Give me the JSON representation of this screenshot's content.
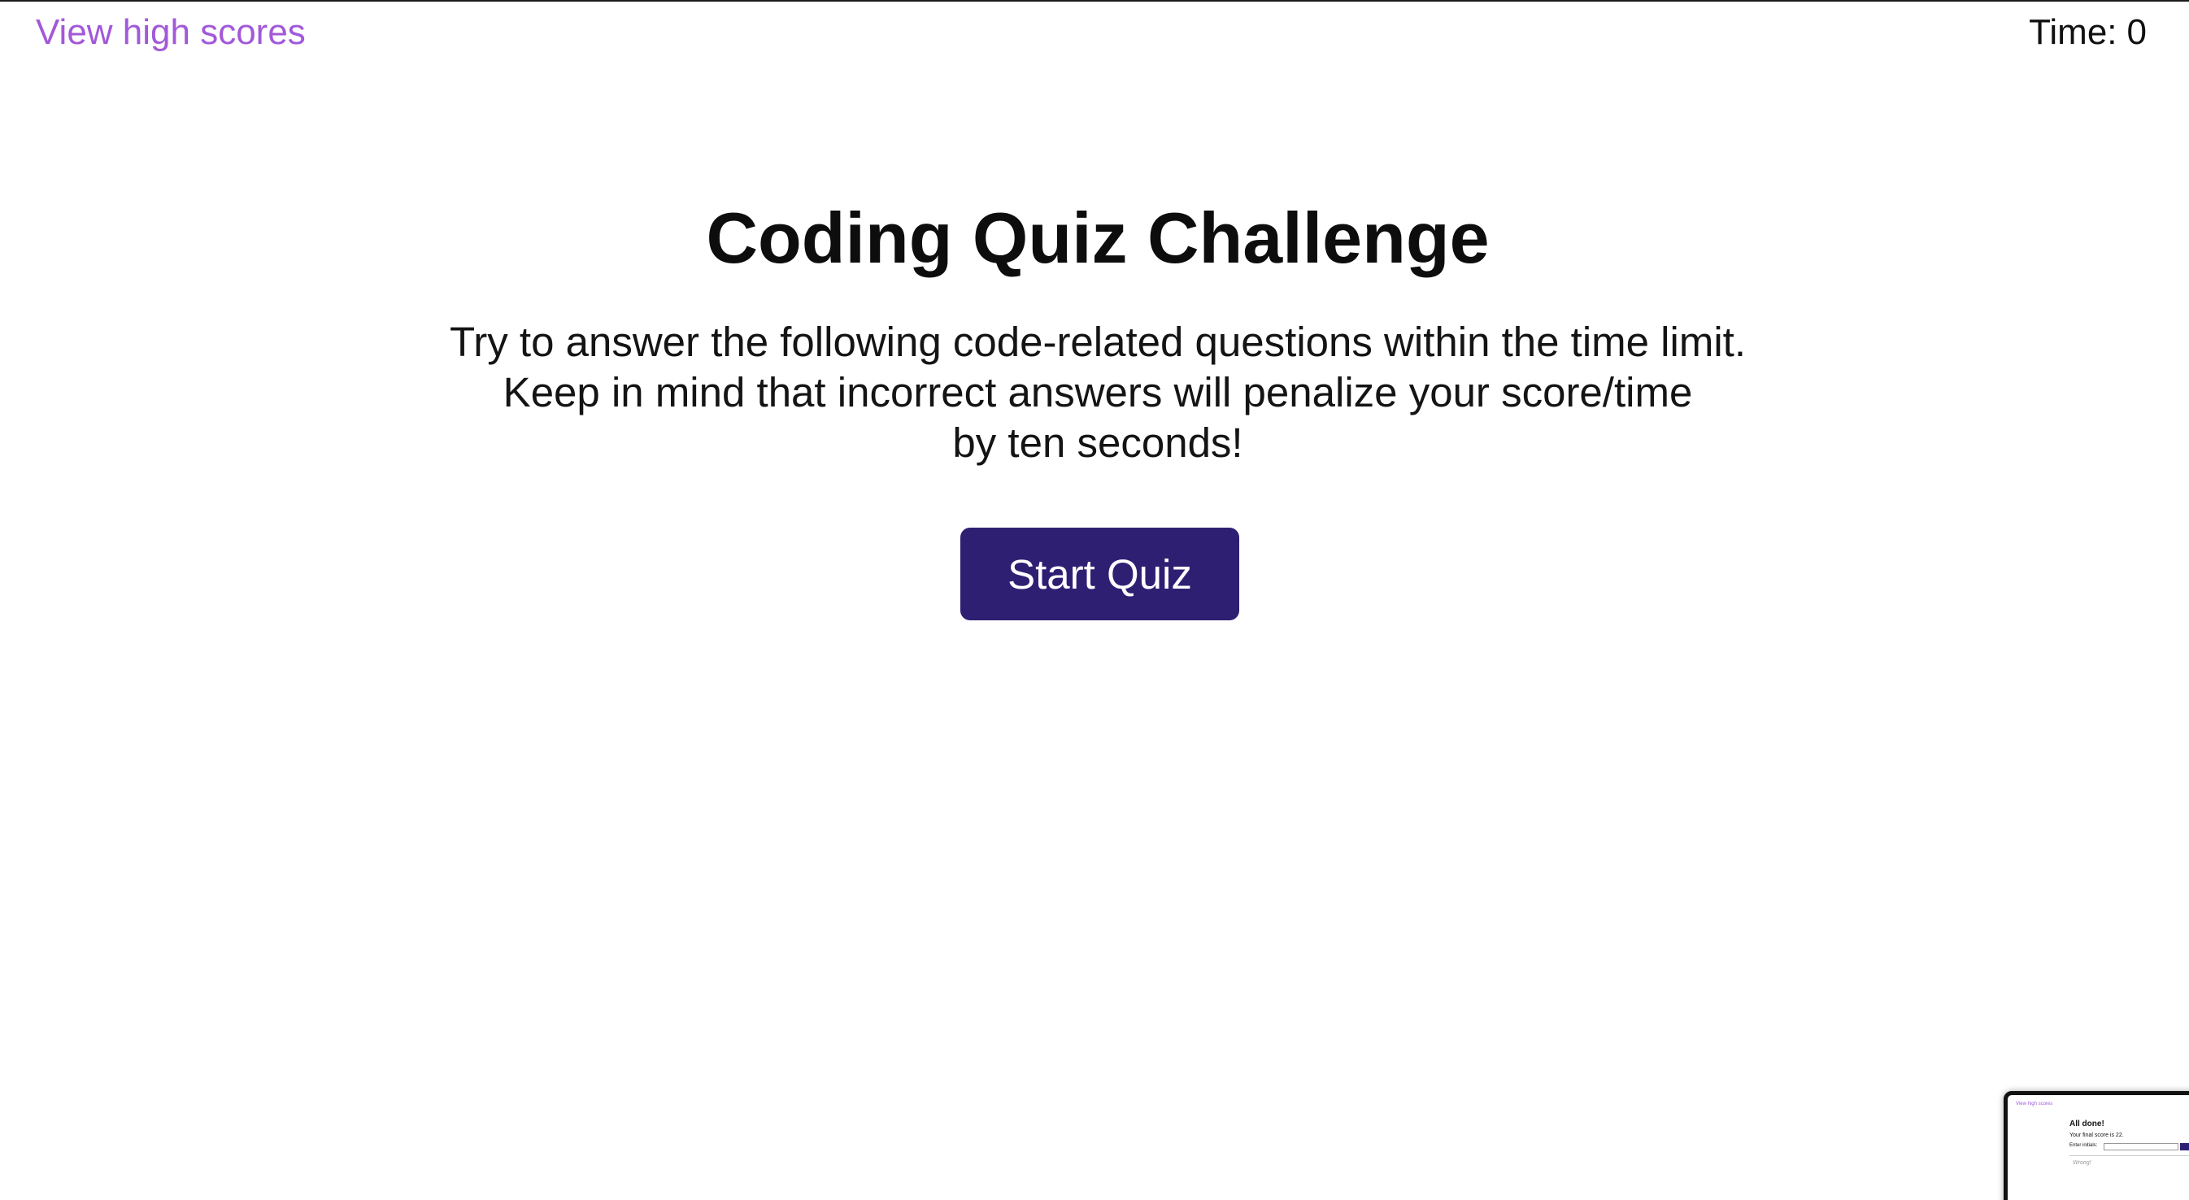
{
  "header": {
    "high_scores_link": "View high scores",
    "timer_label": "Time:",
    "timer_value": "0"
  },
  "main": {
    "title": "Coding Quiz Challenge",
    "intro_lines": [
      "Try to answer the following code-related questions within the time limit.",
      "Keep in mind that incorrect answers will penalize your score/time",
      "by ten seconds!"
    ],
    "start_button": "Start Quiz"
  },
  "thumbnail": {
    "link": "View high scores",
    "title": "All done!",
    "score_text": "Your final score is 22.",
    "initials_label": "Enter initials:",
    "feedback": "Wrong!"
  },
  "colors": {
    "link": "#a259d9",
    "button_bg": "#2e1f73",
    "button_text": "#ffffff",
    "text": "#111111"
  }
}
